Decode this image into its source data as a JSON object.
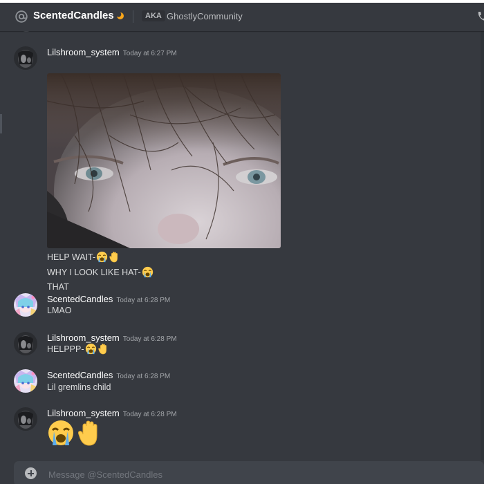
{
  "header": {
    "dm_name": "ScentedCandles",
    "status_icon": "moon-icon",
    "aka_label": "AKA",
    "nickname": "GhostlyCommunity"
  },
  "messages": [
    {
      "author": "Lilshroom_system",
      "timestamp": "Today at 6:27 PM",
      "attachment": "photo-attachment",
      "lines": [
        {
          "text": "HELP WAIT-",
          "emojis": [
            "loudly-crying-face",
            "raised-hand"
          ]
        },
        {
          "text": "WHY I LOOK LIKE HAT-",
          "emojis": [
            "loudly-crying-face"
          ]
        },
        {
          "text": "THAT",
          "emojis": []
        }
      ]
    },
    {
      "author": "ScentedCandles",
      "timestamp": "Today at 6:28 PM",
      "lines": [
        {
          "text": "LMAO",
          "emojis": []
        }
      ]
    },
    {
      "author": "Lilshroom_system",
      "timestamp": "Today at 6:28 PM",
      "lines": [
        {
          "text": "HELPPP-",
          "emojis": [
            "loudly-crying-face",
            "raised-hand"
          ]
        }
      ]
    },
    {
      "author": "ScentedCandles",
      "timestamp": "Today at 6:28 PM",
      "lines": [
        {
          "text": "Lil gremlins child",
          "emojis": []
        }
      ]
    },
    {
      "author": "Lilshroom_system",
      "timestamp": "Today at 6:28 PM",
      "jumbo_emojis": [
        "loudly-crying-face",
        "raised-hand"
      ]
    }
  ],
  "composer": {
    "placeholder": "Message @ScentedCandles"
  },
  "colors": {
    "background": "#36393f",
    "header_text": "#ffffff",
    "message_text": "#dcddde",
    "muted_text": "#a3a6aa",
    "composer_bg": "#40444b"
  }
}
